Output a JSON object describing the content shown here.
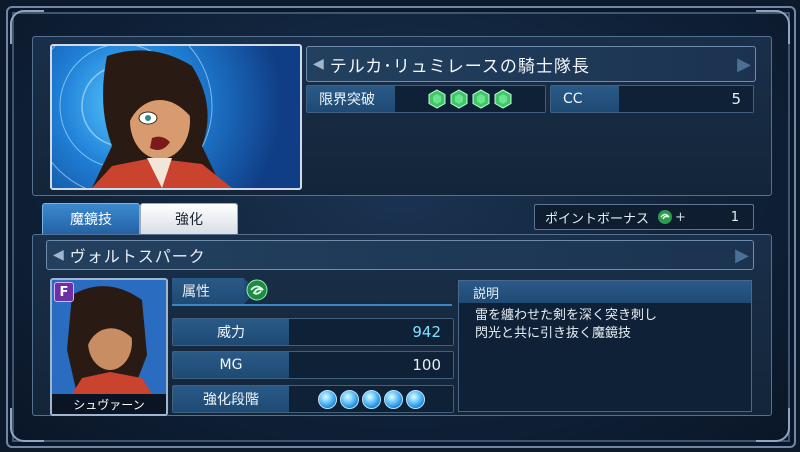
{
  "unit": {
    "title": "テルカ･リュミレースの騎士隊長",
    "limit_break_label": "限界突破",
    "limit_break_count": 4,
    "cc_label": "CC",
    "cc_value": "5"
  },
  "tabs": [
    {
      "label": "魔鏡技",
      "active": true
    },
    {
      "label": "強化",
      "active": false
    }
  ],
  "point_bonus": {
    "label": "ポイントボーナス",
    "plus": "+",
    "value": "1"
  },
  "skill": {
    "name": "ヴォルトスパーク",
    "character_name": "シュヴァーン",
    "rank_badge": "F",
    "attribute_label": "属性",
    "attribute_icon": "wind-element-icon",
    "power_label": "威力",
    "power_value": "942",
    "mg_label": "MG",
    "mg_value": "100",
    "enhance_label": "強化段階",
    "enhance_level": 5,
    "description_label": "説明",
    "description": "雷を纏わせた剣を深く突き刺し\n閃光と共に引き抜く魔鏡技"
  },
  "colors": {
    "accent_blue": "#2b5a88",
    "power_value": "#7fe0ff",
    "gem_green": "#3fc86a"
  }
}
